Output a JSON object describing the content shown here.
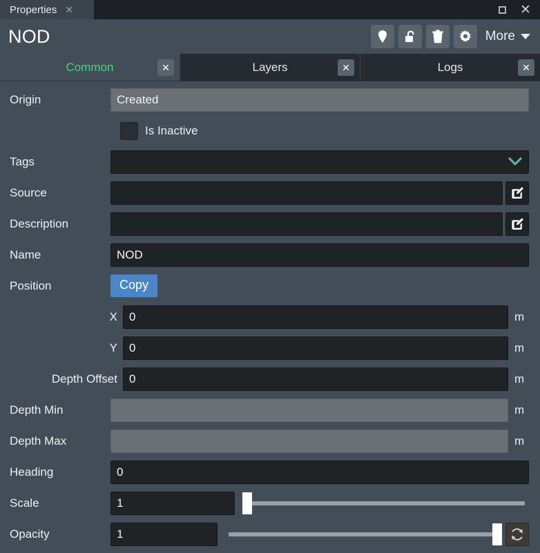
{
  "window": {
    "tab_label": "Properties",
    "tab_close": "✕",
    "restore_icon": "restore-window-icon",
    "close_icon": "close-window-icon"
  },
  "header": {
    "object_name": "NOD",
    "toolbar": [
      {
        "name": "pin-icon",
        "label": "Pin"
      },
      {
        "name": "unlock-icon",
        "label": "Unlock"
      },
      {
        "name": "trash-icon",
        "label": "Delete"
      },
      {
        "name": "gear-icon",
        "label": "Settings"
      }
    ],
    "more_label": "More"
  },
  "tabs": [
    {
      "label": "Common",
      "active": true,
      "close": "✕"
    },
    {
      "label": "Layers",
      "active": false,
      "close": "✕"
    },
    {
      "label": "Logs",
      "active": false,
      "close": "✕"
    }
  ],
  "form": {
    "origin": {
      "label": "Origin",
      "value": "Created"
    },
    "is_inactive": {
      "label": "Is Inactive",
      "checked": false
    },
    "tags": {
      "label": "Tags",
      "value": "",
      "chevron": "chevron-down-icon"
    },
    "source": {
      "label": "Source",
      "value": "",
      "edit_icon": "edit-icon"
    },
    "description": {
      "label": "Description",
      "value": "",
      "edit_icon": "edit-icon"
    },
    "name": {
      "label": "Name",
      "value": "NOD"
    },
    "position": {
      "label": "Position",
      "copy_label": "Copy"
    },
    "x": {
      "label": "X",
      "value": "0",
      "unit": "m"
    },
    "y": {
      "label": "Y",
      "value": "0",
      "unit": "m"
    },
    "depth_offset": {
      "label": "Depth Offset",
      "value": "0",
      "unit": "m"
    },
    "depth_min": {
      "label": "Depth Min",
      "value": "",
      "unit": "m"
    },
    "depth_max": {
      "label": "Depth Max",
      "value": "",
      "unit": "m"
    },
    "heading": {
      "label": "Heading",
      "value": "0"
    },
    "scale": {
      "label": "Scale",
      "value": "1",
      "slider_percent": 2
    },
    "opacity": {
      "label": "Opacity",
      "value": "1",
      "slider_percent": 98,
      "reset_icon": "refresh-icon"
    }
  },
  "colors": {
    "background": "#434d57",
    "titlebar": "#1d2125",
    "tab_active_text": "#3ddb7e",
    "accent_button": "#4a86c8",
    "chevron": "#5bb899",
    "field": "#202326",
    "readonly_field": "#6b7075"
  }
}
